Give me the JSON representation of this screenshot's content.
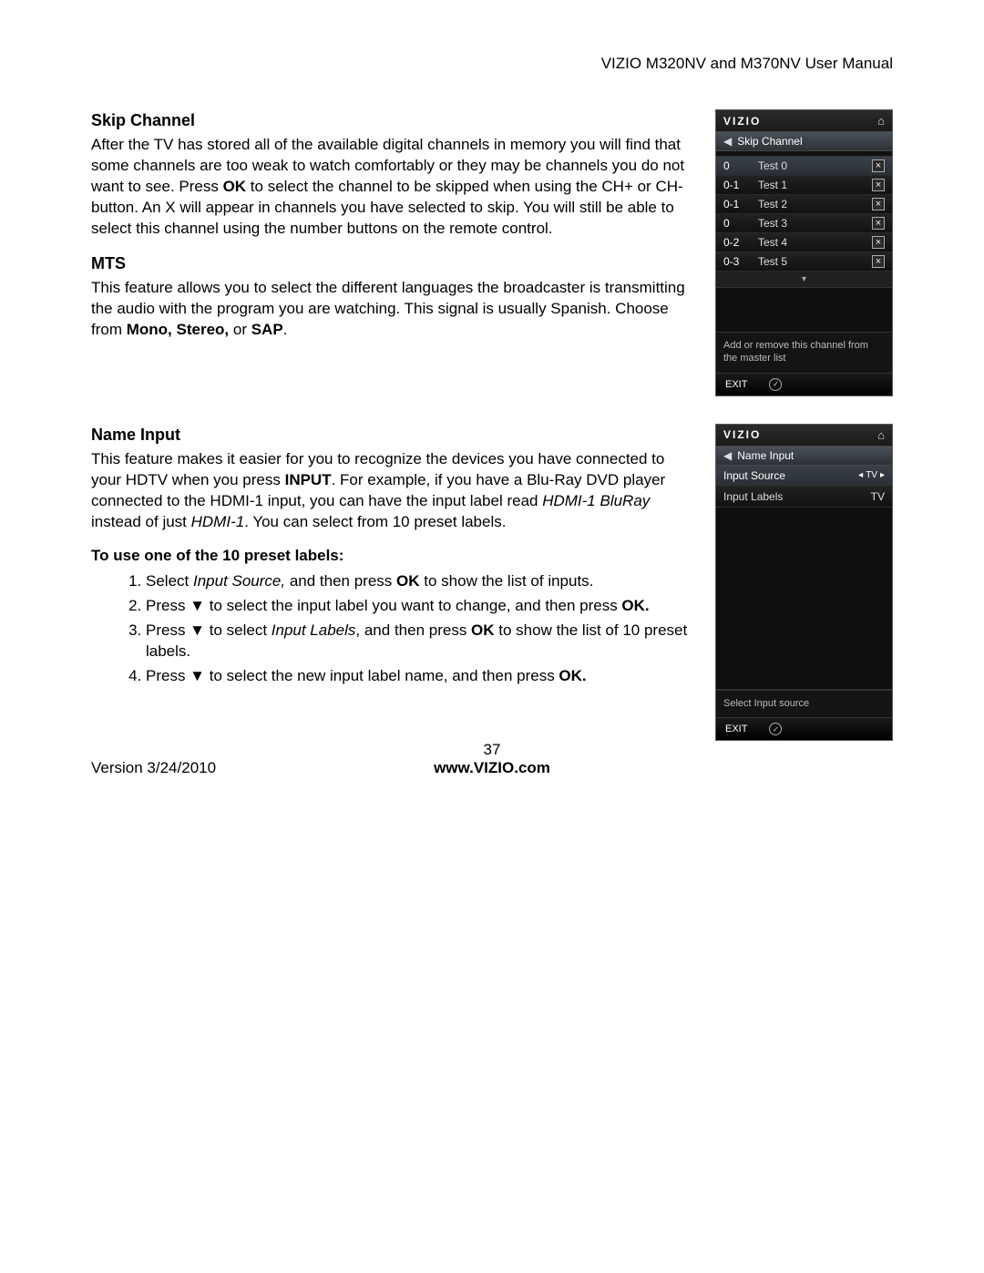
{
  "doc": {
    "header": "VIZIO M320NV and M370NV User Manual",
    "version": "Version 3/24/2010",
    "pagenum": "37",
    "site": "www.VIZIO.com"
  },
  "sections": {
    "skip_channel": {
      "title": "Skip Channel",
      "body_a": "After the TV has stored all of the available digital channels in memory you will find that some channels are too weak to watch comfortably or they may be channels you do not want to see. Press ",
      "body_ok": "OK",
      "body_b": " to select the channel to be skipped when using the CH+ or CH- button. An X will appear in channels you have selected to skip. You will still be able to select this channel using the number buttons on the remote control."
    },
    "mts": {
      "title": "MTS",
      "body_a": "This feature allows you to select the different languages the broadcaster is transmitting the audio with the program you are watching. This signal is usually Spanish. Choose from ",
      "body_b": "Mono, Stereo,",
      "body_c": " or ",
      "body_d": "SAP",
      "body_e": "."
    },
    "name_input": {
      "title": "Name Input",
      "p1_a": "This feature makes it easier for you to recognize the devices you have connected to your HDTV when you press ",
      "p1_b": "INPUT",
      "p1_c": ". For example, if you have a Blu-Ray DVD player connected to the HDMI-1 input, you can have the input label read ",
      "p1_d": "HDMI-1 BluRay",
      "p1_e": " instead of just ",
      "p1_f": "HDMI-1",
      "p1_g": ". You can select from 10 preset labels.",
      "sub": "To use one of the 10 preset labels:",
      "li1_a": "Select ",
      "li1_b": "Input Source,",
      "li1_c": " and then press ",
      "li1_d": "OK",
      "li1_e": " to show the list of inputs.",
      "li2_a": "Press ▼ to select the input label you want to change, and then press ",
      "li2_b": "OK.",
      "li3_a": "Press ▼ to select ",
      "li3_b": "Input Labels",
      "li3_c": ", and then press ",
      "li3_d": "OK",
      "li3_e": " to show the list of 10 preset labels.",
      "li4_a": "Press ▼ to select the new input label name, and then press ",
      "li4_b": "OK."
    }
  },
  "osd1": {
    "brand": "VIZIO",
    "title": "Skip Channel",
    "rows": [
      {
        "num": "0",
        "label": "Test 0",
        "checked": true,
        "sel": true
      },
      {
        "num": "0-1",
        "label": "Test 1",
        "checked": true,
        "sel": false
      },
      {
        "num": "0-1",
        "label": "Test 2",
        "checked": true,
        "sel": false
      },
      {
        "num": "0",
        "label": "Test 3",
        "checked": true,
        "sel": false
      },
      {
        "num": "0-2",
        "label": "Test 4",
        "checked": true,
        "sel": false
      },
      {
        "num": "0-3",
        "label": "Test 5",
        "checked": true,
        "sel": false
      }
    ],
    "note": "Add or remove this channel from the master list",
    "exit": "EXIT"
  },
  "osd2": {
    "brand": "VIZIO",
    "title": "Name Input",
    "rows": [
      {
        "label": "Input Source",
        "value": "TV",
        "sel": true,
        "arrows": true
      },
      {
        "label": "Input Labels",
        "value": "TV",
        "sel": false,
        "arrows": false
      }
    ],
    "note": "Select Input source",
    "exit": "EXIT"
  }
}
